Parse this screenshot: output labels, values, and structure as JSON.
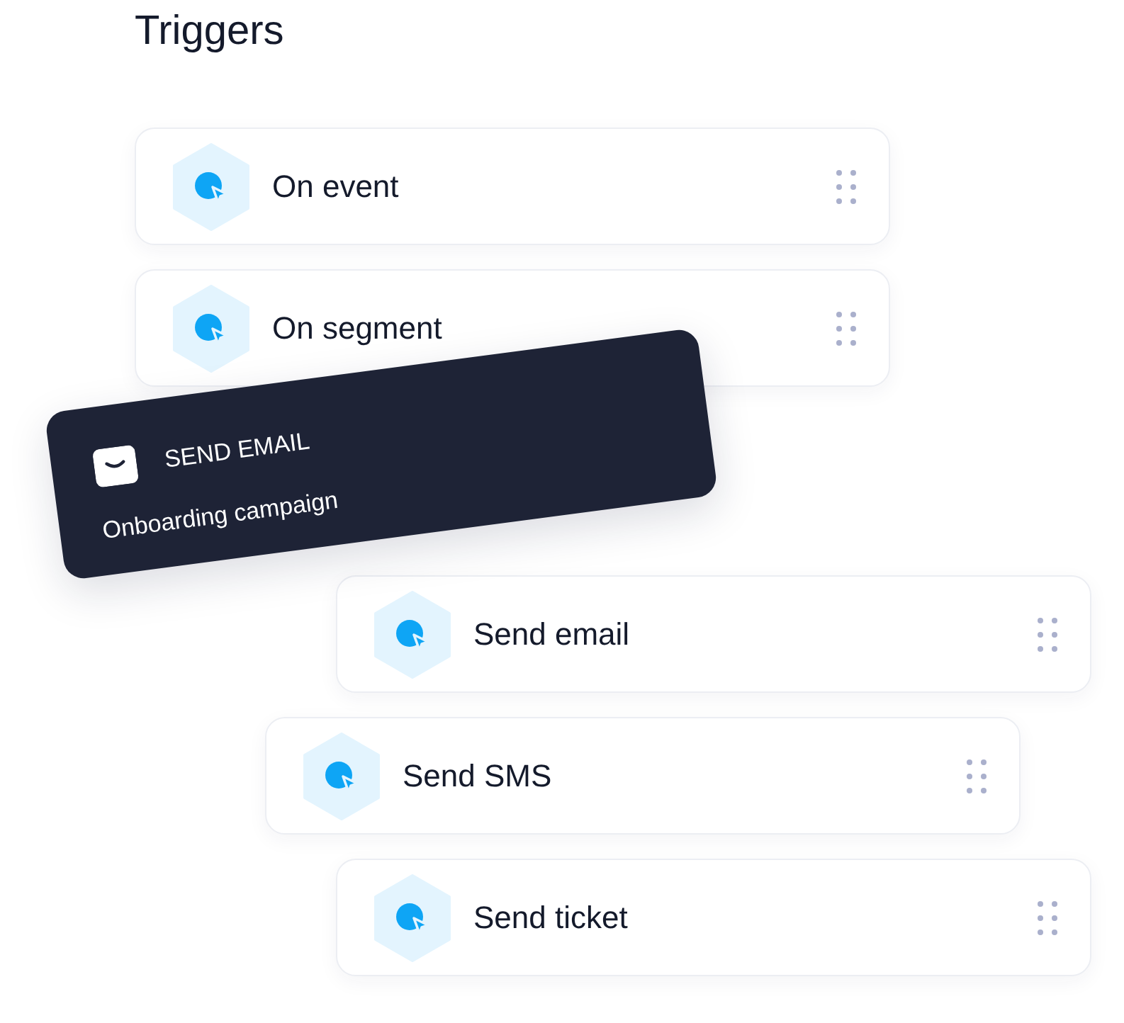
{
  "title": "Triggers",
  "cards": [
    {
      "label": "On event"
    },
    {
      "label": "On segment"
    },
    {
      "label": "Send email"
    },
    {
      "label": "Send SMS"
    },
    {
      "label": "Send ticket"
    }
  ],
  "dragged_card": {
    "title": "SEND EMAIL",
    "subtitle": "Onboarding campaign"
  }
}
